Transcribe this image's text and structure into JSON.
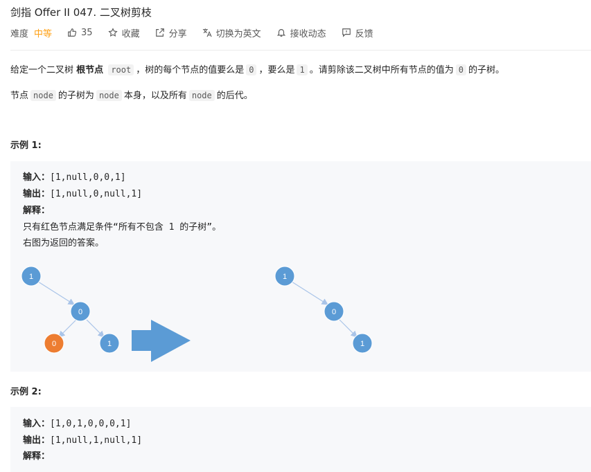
{
  "problem": {
    "title": "剑指 Offer II 047. 二叉树剪枝"
  },
  "meta": {
    "difficulty_label": "难度",
    "difficulty_value": "中等",
    "likes": "35",
    "favorite": "收藏",
    "share": "分享",
    "translate": "切换为英文",
    "notify": "接收动态",
    "feedback": "反馈"
  },
  "description": {
    "p1_a": "给定一个二叉树",
    "p1_b": "根节点",
    "p1_code1": "root",
    "p1_c": "，树的每个节点的值要么是",
    "p1_code2": "0",
    "p1_d": "，要么是",
    "p1_code3": "1",
    "p1_e": "。请剪除该二叉树中所有节点的值为",
    "p1_code4": "0",
    "p1_f": "的子树。",
    "p2_a": "节点",
    "p2_code1": "node",
    "p2_b": "的子树为",
    "p2_code2": "node",
    "p2_c": "本身，以及所有",
    "p2_code3": "node",
    "p2_d": "的后代。"
  },
  "example1": {
    "title": "示例 1:",
    "input_label": "输入：",
    "input_value": "[1,null,0,0,1]",
    "output_label": "输出：",
    "output_value": "[1,null,0,null,1]",
    "explain_label": "解释：",
    "explain_line1": "只有红色节点满足条件“所有不包含 1 的子树”。",
    "explain_line2": "右图为返回的答案。",
    "left_tree": {
      "root": "1",
      "mid": "0",
      "red_leaf": "0",
      "blue_leaf": "1"
    },
    "right_tree": {
      "root": "1",
      "mid": "0",
      "leaf": "1"
    }
  },
  "example2": {
    "title": "示例 2:",
    "input_label": "输入：",
    "input_value": "[1,0,1,0,0,0,1]",
    "output_label": "输出：",
    "output_value": "[1,null,1,null,1]",
    "explain_label": "解释："
  },
  "colors": {
    "node_blue": "#5b9bd5",
    "node_red": "#ed7d31",
    "arrow_blue": "#5b9bd5",
    "accent_orange": "#ffa116"
  }
}
